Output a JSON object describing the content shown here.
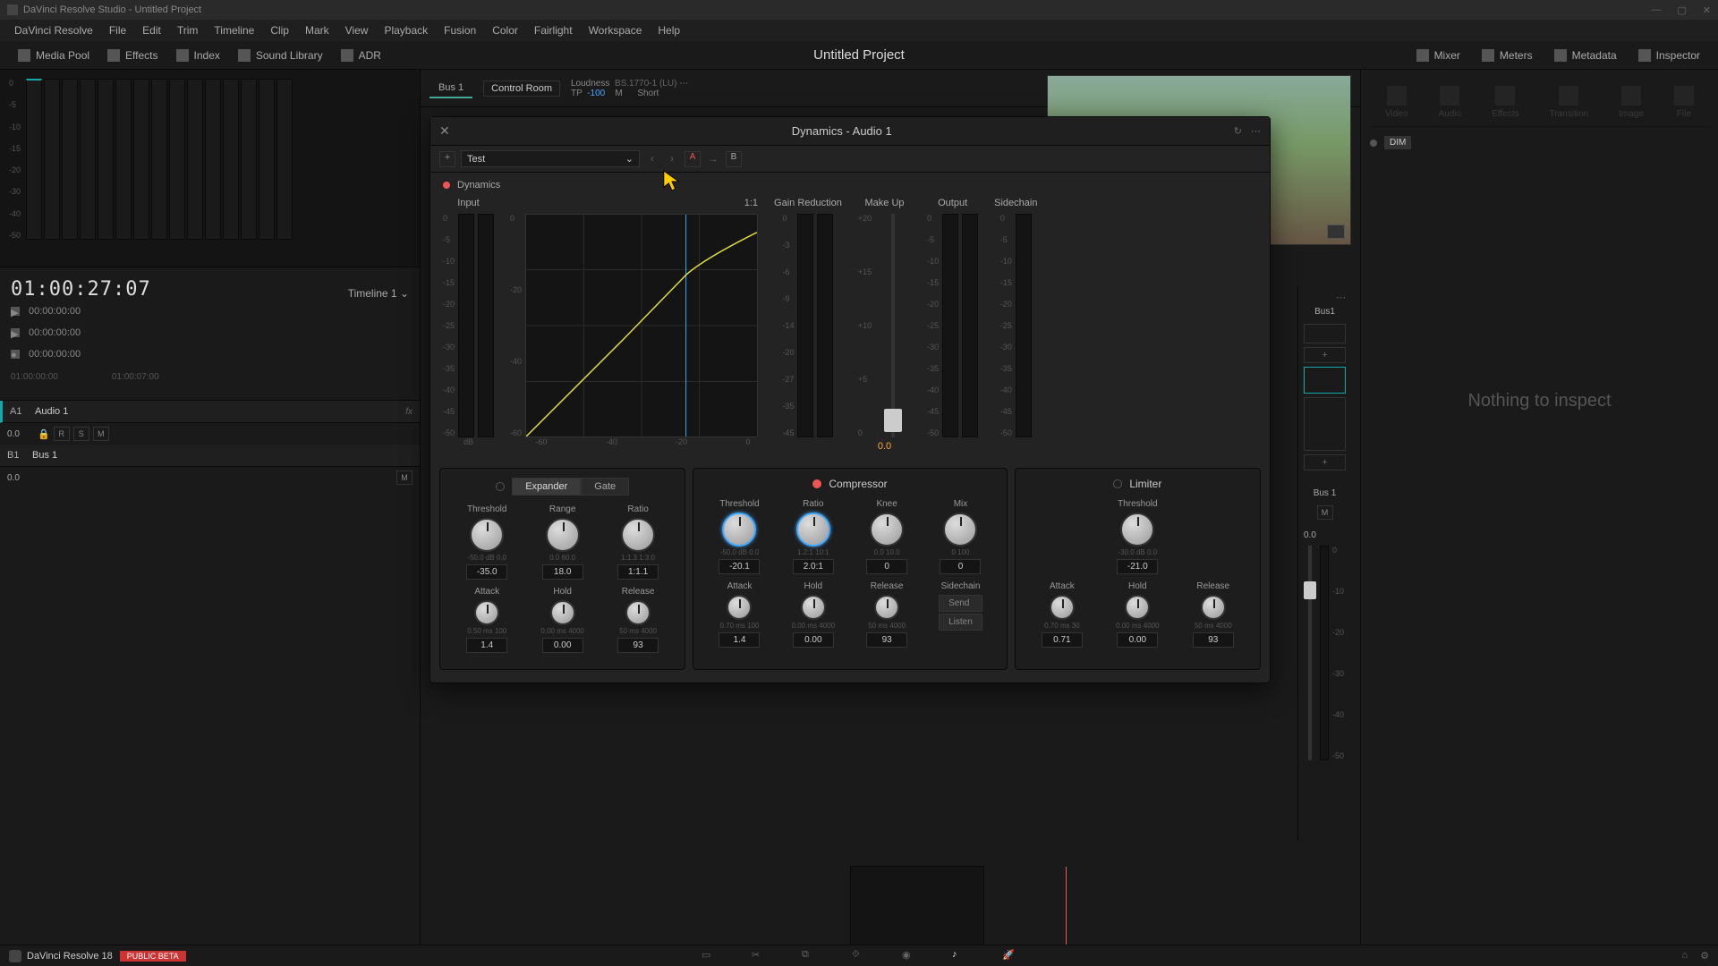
{
  "titlebar": {
    "text": "DaVinci Resolve Studio - Untitled Project"
  },
  "menu": [
    "DaVinci Resolve",
    "File",
    "Edit",
    "Trim",
    "Timeline",
    "Clip",
    "Mark",
    "View",
    "Playback",
    "Fusion",
    "Color",
    "Fairlight",
    "Workspace",
    "Help"
  ],
  "toolbar": {
    "left": [
      {
        "icon": "media-pool-icon",
        "label": "Media Pool"
      },
      {
        "icon": "effects-icon",
        "label": "Effects"
      },
      {
        "icon": "index-icon",
        "label": "Index"
      },
      {
        "icon": "sound-library-icon",
        "label": "Sound Library"
      },
      {
        "icon": "adr-icon",
        "label": "ADR"
      }
    ],
    "title": "Untitled Project",
    "right": [
      {
        "icon": "mixer-icon",
        "label": "Mixer"
      },
      {
        "icon": "meters-icon",
        "label": "Meters"
      },
      {
        "icon": "metadata-icon",
        "label": "Metadata"
      },
      {
        "icon": "inspector-icon",
        "label": "Inspector"
      }
    ]
  },
  "meter_scale": [
    "0",
    "-5",
    "-10",
    "-15",
    "-20",
    "-30",
    "-40",
    "-50"
  ],
  "timecode": {
    "main": "01:00:27:07",
    "timeline": "Timeline 1",
    "rows": [
      "00:00:00:00",
      "00:00:00:00",
      "00:00:00:00"
    ],
    "ruler": [
      "01:00:00:00",
      "01:00:07:00"
    ]
  },
  "tracks": [
    {
      "id": "A1",
      "name": "Audio 1",
      "fx": "fx",
      "val": "0.0",
      "btns": [
        "R",
        "S",
        "M"
      ],
      "color": "#1aa"
    },
    {
      "id": "B1",
      "name": "Bus 1",
      "fx": "",
      "val": "0.0",
      "btns": [
        "M"
      ],
      "color": "#888"
    }
  ],
  "center_top": {
    "bus": "Bus 1",
    "control_room": "Control Room",
    "loudness_label": "Loudness",
    "loudness_std": "BS.1770-1 (LU)",
    "tp_label": "TP",
    "tp_val": "-100",
    "m_label": "M",
    "short_label": "Short"
  },
  "dialog": {
    "title": "Dynamics - Audio 1",
    "preset": "Test",
    "ab": [
      "A",
      "B"
    ],
    "section": "Dynamics",
    "columns": {
      "input": "Input",
      "ratio": "1:1",
      "gr": "Gain Reduction",
      "makeup": "Make Up",
      "output": "Output",
      "sidechain": "Sidechain"
    },
    "input_scale": [
      "0",
      "-5",
      "-10",
      "-15",
      "-20",
      "-25",
      "-30",
      "-35",
      "-40",
      "-45",
      "-50",
      "dB"
    ],
    "graph_x": [
      "-60",
      "-40",
      "-20",
      "0"
    ],
    "graph_y": [
      "0",
      "-20",
      "-40",
      "-60"
    ],
    "gr_scale": [
      "0",
      "-3",
      "-6",
      "-9",
      "-14",
      "-20",
      "-27",
      "-35",
      "-45"
    ],
    "makeup_scale": [
      "+20",
      "+15",
      "+10",
      "+5",
      "0"
    ],
    "makeup_val": "0.0",
    "out_scale": [
      "0",
      "-5",
      "-10",
      "-15",
      "-20",
      "-25",
      "-30",
      "-35",
      "-40",
      "-45",
      "-50"
    ]
  },
  "expander": {
    "title_a": "Expander",
    "title_b": "Gate",
    "row1": [
      {
        "label": "Threshold",
        "range": "-50.0 dB   0.0",
        "val": "-35.0"
      },
      {
        "label": "Range",
        "range": "0.0      60.0",
        "val": "18.0"
      },
      {
        "label": "Ratio",
        "range": "1:1.3    1:3.0",
        "val": "1:1.1"
      }
    ],
    "row2": [
      {
        "label": "Attack",
        "range": "0.50  ms  100",
        "val": "1.4"
      },
      {
        "label": "Hold",
        "range": "0.00  ms  4000",
        "val": "0.00"
      },
      {
        "label": "Release",
        "range": "50  ms  4000",
        "val": "93"
      }
    ]
  },
  "compressor": {
    "title": "Compressor",
    "row1": [
      {
        "label": "Threshold",
        "range": "-50.0 dB   0.0",
        "val": "-20.1"
      },
      {
        "label": "Ratio",
        "range": "1.2:1    10:1",
        "val": "2.0:1"
      },
      {
        "label": "Knee",
        "range": "0.0      10.0",
        "val": "0"
      },
      {
        "label": "Mix",
        "range": "0        100",
        "val": "0"
      }
    ],
    "row2": [
      {
        "label": "Attack",
        "range": "0.70  ms  100",
        "val": "1.4"
      },
      {
        "label": "Hold",
        "range": "0.00  ms  4000",
        "val": "0.00"
      },
      {
        "label": "Release",
        "range": "50  ms  4000",
        "val": "93"
      }
    ],
    "sidechain": {
      "label": "Sidechain",
      "send": "Send",
      "listen": "Listen"
    }
  },
  "limiter": {
    "title": "Limiter",
    "row1": [
      {
        "label": "Threshold",
        "range": "-30.0 dB   0.0",
        "val": "-21.0"
      }
    ],
    "row2": [
      {
        "label": "Attack",
        "range": "0.70  ms  30",
        "val": "0.71"
      },
      {
        "label": "Hold",
        "range": "0.00  ms  4000",
        "val": "0.00"
      },
      {
        "label": "Release",
        "range": "50  ms  4000",
        "val": "93"
      }
    ]
  },
  "inspector": {
    "tabs": [
      "Video",
      "Audio",
      "Effects",
      "Transition",
      "Image",
      "File"
    ],
    "nothing": "Nothing to inspect"
  },
  "mixer": {
    "bus1": "Bus1",
    "bus1_lower": "Bus 1",
    "dim": "DIM",
    "m": "M",
    "val": "0.0",
    "fader_scale": [
      "0",
      "-10",
      "-20",
      "-30",
      "-40",
      "-50"
    ]
  },
  "bottom": {
    "app": "DaVinci Resolve 18",
    "badge": "PUBLIC BETA"
  }
}
